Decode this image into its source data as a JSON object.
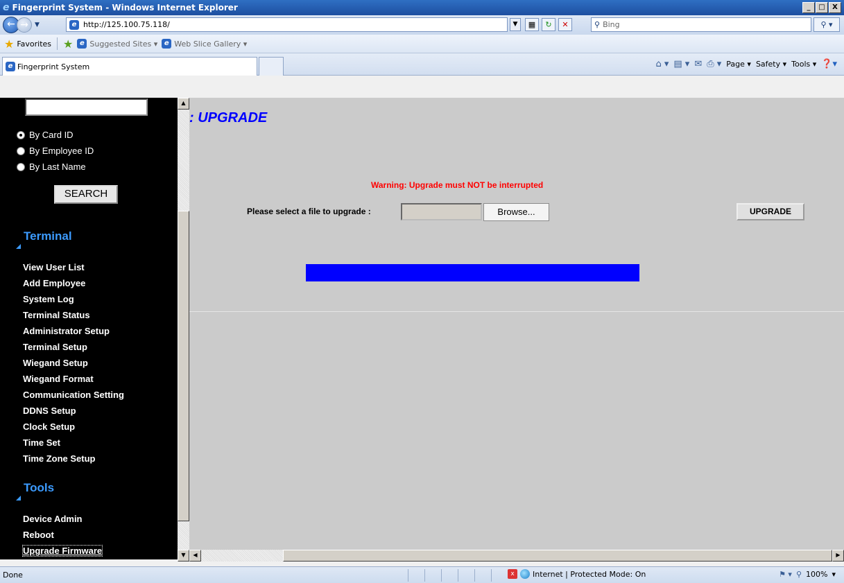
{
  "window": {
    "title": "Fingerprint System - Windows Internet Explorer",
    "min_label": "_",
    "max_label": "□",
    "close_label": "X"
  },
  "address": {
    "url": "http://125.100.75.118/",
    "search_placeholder": "Bing"
  },
  "favorites": {
    "favorites_label": "Favorites",
    "suggested_sites": "Suggested Sites ▾",
    "web_slice_gallery": "Web Slice Gallery ▾"
  },
  "tab": {
    "label": "Fingerprint System"
  },
  "command_bar": {
    "page": "Page ▾",
    "safety": "Safety ▾",
    "tools": "Tools ▾"
  },
  "sidebar": {
    "search_options": [
      {
        "label": "By Card ID",
        "checked": true
      },
      {
        "label": "By Employee ID",
        "checked": false
      },
      {
        "label": "By Last Name",
        "checked": false
      }
    ],
    "search_button": "SEARCH",
    "terminal_heading": "Terminal",
    "terminal_items": [
      "View User List",
      "Add Employee",
      "System Log",
      "Terminal Status",
      "Administrator Setup",
      "Terminal Setup",
      "Wiegand Setup",
      "Wiegand Format",
      "Communication Setting",
      "DDNS Setup",
      "Clock Setup",
      "Time Set",
      "Time Zone Setup"
    ],
    "tools_heading": "Tools",
    "tools_items": [
      "Device Admin",
      "Reboot",
      "Upgrade Firmware"
    ]
  },
  "main": {
    "title": "UPGRADE",
    "warning": "Warning: Upgrade must NOT be interrupted",
    "file_label": "Please select a file to upgrade :",
    "browse_button": "Browse...",
    "upgrade_button": "UPGRADE",
    "progress_fraction": 1.0,
    "progress_color": "#0000ff"
  },
  "status": {
    "done": "Done",
    "zone": "Internet | Protected Mode: On",
    "zoom": "100%"
  }
}
